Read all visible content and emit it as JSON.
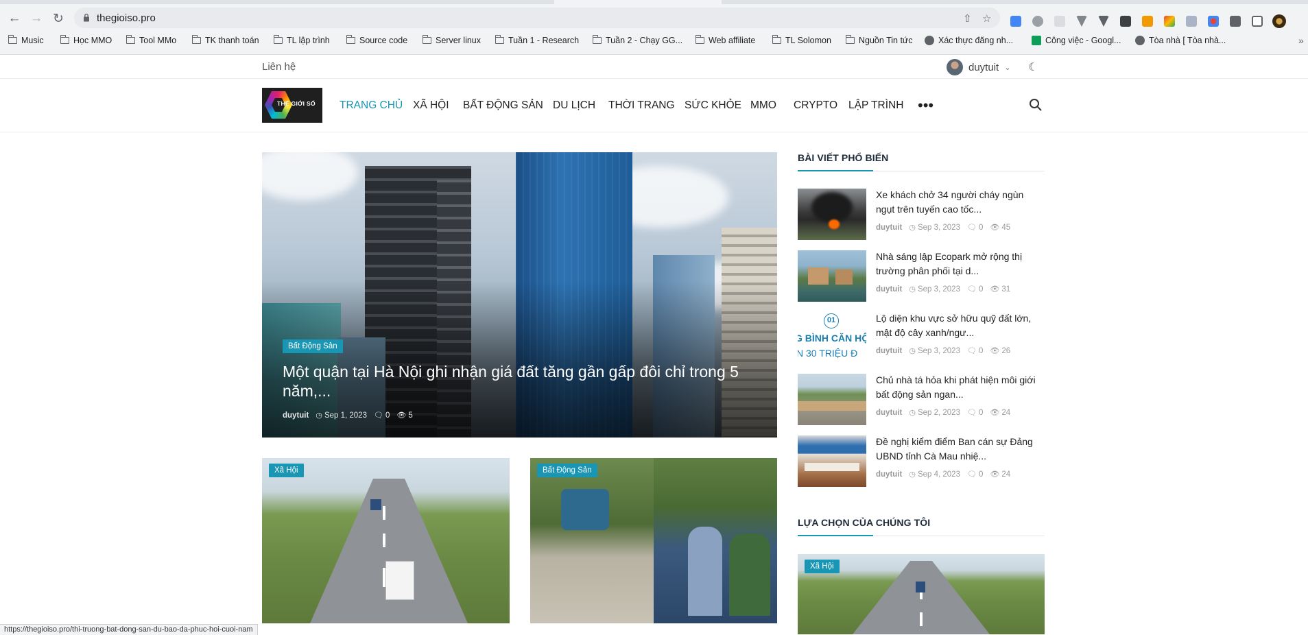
{
  "browser": {
    "url": "thegioiso.pro",
    "bookmarks": [
      {
        "label": "Music",
        "type": "folder"
      },
      {
        "label": "Học MMO",
        "type": "folder"
      },
      {
        "label": "Tool MMo",
        "type": "folder"
      },
      {
        "label": "TK thanh toán",
        "type": "folder"
      },
      {
        "label": "TL lập trình",
        "type": "folder"
      },
      {
        "label": "Source code",
        "type": "folder"
      },
      {
        "label": "Server linux",
        "type": "folder"
      },
      {
        "label": "Tuần 1 - Research",
        "type": "folder"
      },
      {
        "label": "Tuần 2 - Chạy GG...",
        "type": "folder"
      },
      {
        "label": "Web affiliate",
        "type": "folder"
      },
      {
        "label": "TL Solomon",
        "type": "folder"
      },
      {
        "label": "Nguồn Tin tức",
        "type": "folder"
      },
      {
        "label": "Xác thực đăng nh...",
        "type": "site"
      },
      {
        "label": "Công việc - Googl...",
        "type": "sheet"
      },
      {
        "label": "Tòa nhà [ Tòa nhà...",
        "type": "site"
      }
    ],
    "overflow_label": "»",
    "status_url": "https://thegioiso.pro/thi-truong-bat-dong-san-du-bao-da-phuc-hoi-cuoi-nam"
  },
  "topbar": {
    "contact": "Liên hệ",
    "username": "duytuit"
  },
  "logo_text": "THẾ GIỚI SỐ",
  "menu": [
    "TRANG CHỦ",
    "XÃ HỘI",
    "BẤT ĐỘNG SẢN",
    "DU LỊCH",
    "THỜI TRANG",
    "SỨC KHỎE",
    "MMO",
    "CRYPTO",
    "LẬP TRÌNH"
  ],
  "menu_more": "•••",
  "hero": {
    "category": "Bất Động Sản",
    "title": "Một quận tại Hà Nội ghi nhận giá đất tăng gần gấp đôi chỉ trong 5 năm,...",
    "author": "duytuit",
    "date": "Sep 1, 2023",
    "comments": "0",
    "views": "5"
  },
  "cards": [
    {
      "category": "Xã Hội"
    },
    {
      "category": "Bất Động Sản"
    }
  ],
  "sidebar": {
    "popular_title": "BÀI VIẾT PHỔ BIẾN",
    "popular": [
      {
        "title": "Xe khách chở 34 người cháy ngùn ngụt trên tuyến cao tốc...",
        "author": "duytuit",
        "date": "Sep 3, 2023",
        "comments": "0",
        "views": "45"
      },
      {
        "title": "Nhà sáng lập Ecopark mở rộng thị trường phân phối tại d...",
        "author": "duytuit",
        "date": "Sep 3, 2023",
        "comments": "0",
        "views": "31"
      },
      {
        "title": "Lộ diện khu vực sở hữu quỹ đất lớn, mật độ cây xanh/ngư...",
        "author": "duytuit",
        "date": "Sep 3, 2023",
        "comments": "0",
        "views": "26",
        "thumb_text_1": "01",
        "thumb_text_2": "G BÌNH CĂN HỘ",
        "thumb_text_3": "N 30 TRIỆU Đ"
      },
      {
        "title": "Chủ nhà tá hỏa khi phát hiện môi giới bất động sản ngan...",
        "author": "duytuit",
        "date": "Sep 2, 2023",
        "comments": "0",
        "views": "24"
      },
      {
        "title": "Đề nghị kiểm điểm Ban cán sự Đảng UBND tỉnh Cà Mau nhiệ...",
        "author": "duytuit",
        "date": "Sep 4, 2023",
        "comments": "0",
        "views": "24"
      }
    ],
    "picks_title": "LỰA CHỌN CỦA CHÚNG TÔI",
    "picks": [
      {
        "category": "Xã Hội"
      }
    ]
  },
  "colors": {
    "accent": "#1a96b5",
    "heading": "#1d2a3a"
  },
  "icons": {
    "comment": "comment-icon",
    "views": "eye-icon",
    "clock": "clock-icon",
    "search": "search-icon",
    "darkmode": "moon-icon"
  }
}
